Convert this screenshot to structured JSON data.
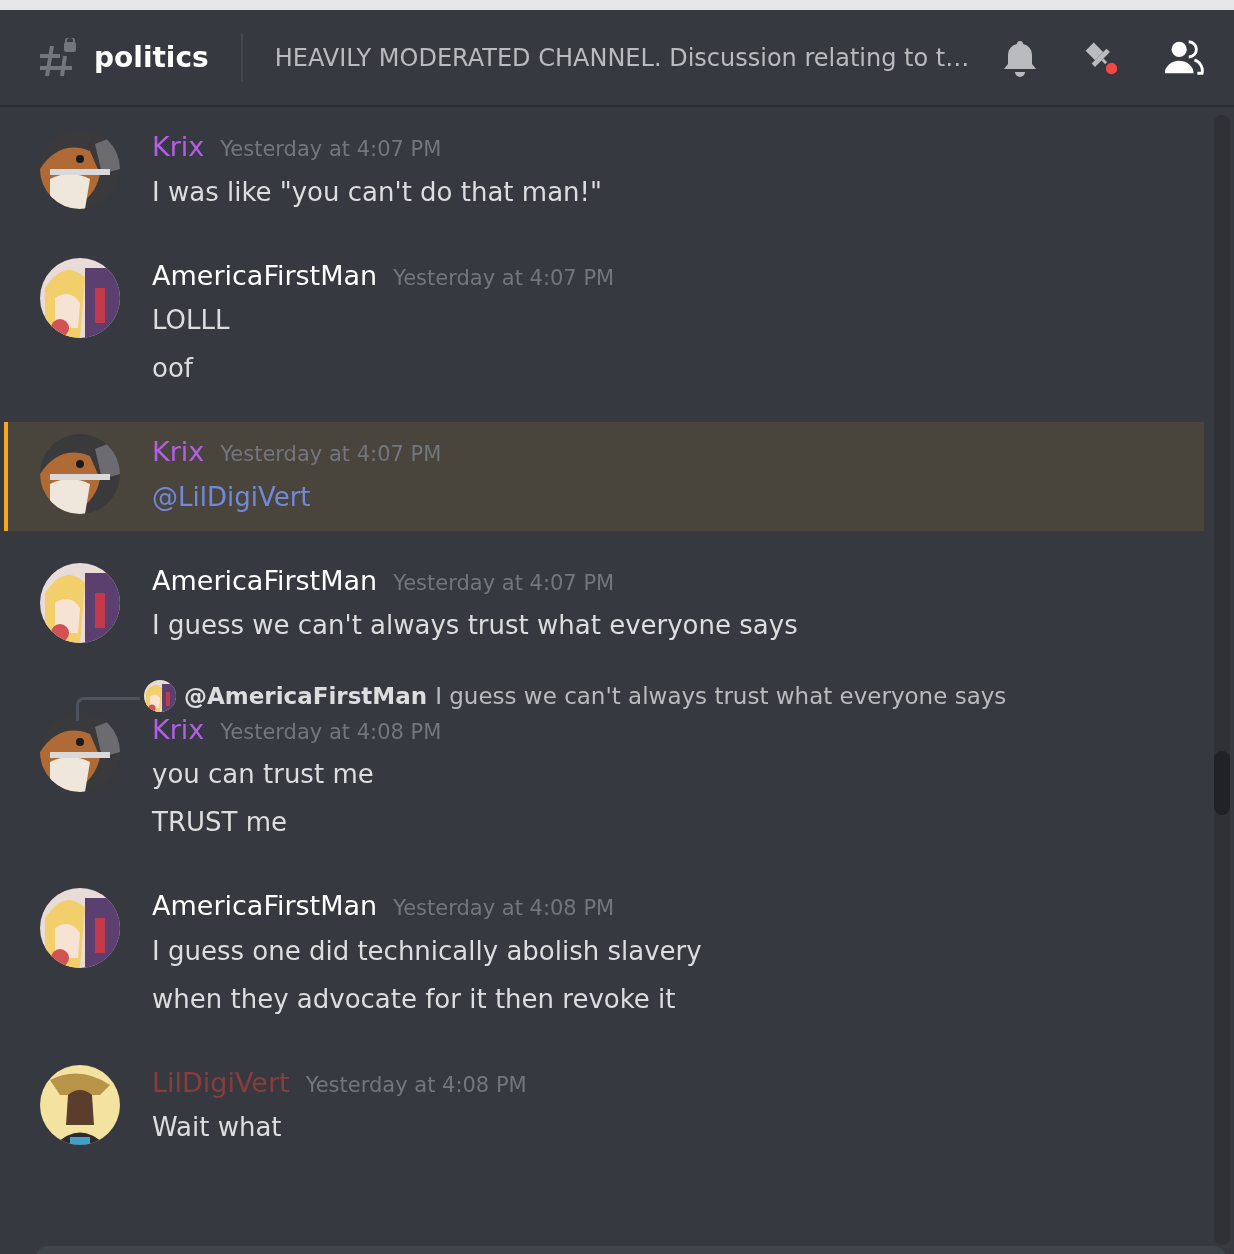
{
  "channel": {
    "name": "politics",
    "topic": "HEAVILY MODERATED CHANNEL. Discussion relating to t…",
    "pins_unread": true
  },
  "messages": [
    {
      "author": "Krix",
      "color": "#b45ee8",
      "time": "Yesterday at 4:07 PM",
      "mentioned": false,
      "avatar": {
        "kind": "picture"
      },
      "lines": [
        {
          "kind": "text",
          "text": "I was like \"you can't do that man!\""
        }
      ]
    },
    {
      "author": "AmericaFirstMan",
      "color": "#ffffff",
      "time": "Yesterday at 4:07 PM",
      "mentioned": false,
      "avatar": {
        "kind": "picture"
      },
      "lines": [
        {
          "kind": "text",
          "text": "LOLLL"
        },
        {
          "kind": "text",
          "text": "oof"
        }
      ]
    },
    {
      "author": "Krix",
      "color": "#b45ee8",
      "time": "Yesterday at 4:07 PM",
      "mentioned": true,
      "avatar": {
        "kind": "picture"
      },
      "lines": [
        {
          "kind": "mention",
          "text": "@LilDigiVert"
        }
      ]
    },
    {
      "author": "AmericaFirstMan",
      "color": "#ffffff",
      "time": "Yesterday at 4:07 PM",
      "mentioned": false,
      "avatar": {
        "kind": "picture"
      },
      "lines": [
        {
          "kind": "text",
          "text": "I guess we can't always trust what everyone says"
        }
      ]
    },
    {
      "author": "Krix",
      "color": "#b45ee8",
      "time": "Yesterday at 4:08 PM",
      "mentioned": false,
      "avatar": {
        "kind": "picture"
      },
      "reply": {
        "author": "@AmericaFirstMan",
        "text": "I guess we can't always trust what everyone says"
      },
      "lines": [
        {
          "kind": "text",
          "text": "you can trust me"
        },
        {
          "kind": "text",
          "text": "TRUST me"
        }
      ]
    },
    {
      "author": "AmericaFirstMan",
      "color": "#ffffff",
      "time": "Yesterday at 4:08 PM",
      "mentioned": false,
      "avatar": {
        "kind": "picture"
      },
      "lines": [
        {
          "kind": "text",
          "text": "I guess one did technically abolish slavery"
        },
        {
          "kind": "text",
          "text": "when they advocate for it then revoke it"
        }
      ]
    },
    {
      "author": "LilDigiVert",
      "color": "#8a3c3c",
      "time": "Yesterday at 4:08 PM",
      "mentioned": false,
      "avatar": {
        "kind": "picture"
      },
      "lines": [
        {
          "kind": "text",
          "text": "Wait what"
        }
      ]
    }
  ]
}
